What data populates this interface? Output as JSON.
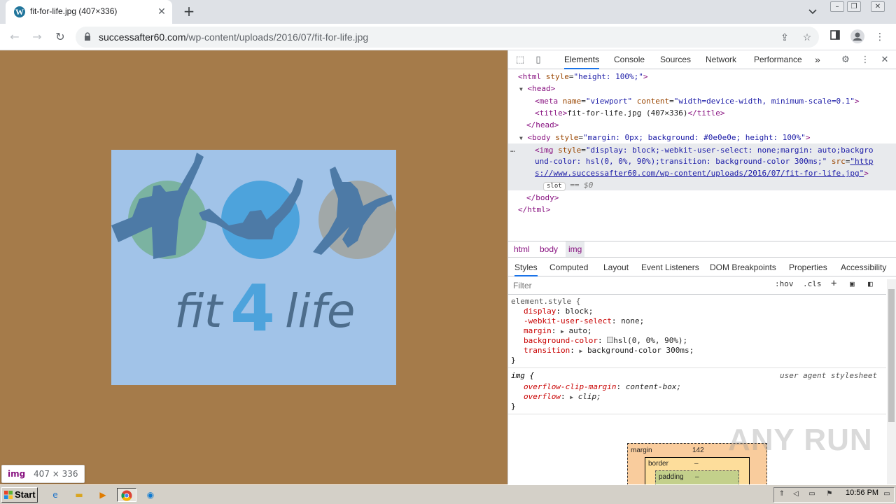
{
  "browser": {
    "tab_title": "fit-for-life.jpg (407×336)",
    "tab_favicon": "wordpress-icon",
    "url_host": "successafter60.com",
    "url_path": "/wp-content/uploads/2016/07/fit-for-life.jpg"
  },
  "page": {
    "background_color": "#a57b4a",
    "image_background": "#a1c3e8",
    "image_alt": "fit-for-life.jpg",
    "logo_text_part1": "fit",
    "logo_text_number": "4",
    "logo_text_part2": "life",
    "tooltip_tag": "img",
    "tooltip_dims": "407 × 336"
  },
  "devtools": {
    "tabs": [
      "Elements",
      "Console",
      "Sources",
      "Network",
      "Performance"
    ],
    "active_tab": "Elements",
    "more_tabs": "»",
    "dom": {
      "html_open": "<html",
      "html_attr": "style",
      "html_val": "\"height: 100%;\"",
      "head_open": "<head>",
      "meta_tag": "<meta",
      "meta_attr1": "name",
      "meta_val1": "\"viewport\"",
      "meta_attr2": "content",
      "meta_val2": "\"width=device-width, minimum-scale=0.1\"",
      "title_open": "<title>",
      "title_text": "fit-for-life.jpg (407×336)",
      "title_close": "</title>",
      "head_close": "</head>",
      "body_open": "<body",
      "body_attr": "style",
      "body_val": "\"margin: 0px; background: #0e0e0e; height: 100%\"",
      "img_tag": "<img",
      "img_attr": "style",
      "img_val_line1": "\"display: block;-webkit-user-select: none;margin: auto;backgro",
      "img_val_line2": "und-color: hsl(0, 0%, 90%);transition: background-color 300ms;\"",
      "img_src_attr": "src",
      "img_src_line1": "\"http",
      "img_src_line2": "s://www.successafter60.com/wp-content/uploads/2016/07/fit-for-life.jpg\"",
      "slot_label": "slot",
      "selected_marker": "== $0",
      "ellipsis": "…",
      "body_close": "</body>",
      "html_close": "</html>"
    },
    "breadcrumbs": [
      "html",
      "body",
      "img"
    ],
    "styles_tabs": [
      "Styles",
      "Computed",
      "Layout",
      "Event Listeners",
      "DOM Breakpoints",
      "Properties",
      "Accessibility"
    ],
    "filter_placeholder": "Filter",
    "filter_hov": ":hov",
    "filter_cls": ".cls",
    "element_style": {
      "selector": "element.style {",
      "rules": [
        {
          "prop": "display",
          "value": "block;"
        },
        {
          "prop": "-webkit-user-select",
          "value": "none;"
        },
        {
          "prop": "margin",
          "value": "auto;"
        },
        {
          "prop": "background-color",
          "value": "hsl(0, 0%, 90%);"
        },
        {
          "prop": "transition",
          "value": "background-color 300ms;"
        }
      ],
      "close": "}"
    },
    "ua_style": {
      "selector": "img {",
      "source": "user agent stylesheet",
      "rules": [
        {
          "prop": "overflow-clip-margin",
          "value": "content-box;"
        },
        {
          "prop": "overflow",
          "value": "clip;"
        }
      ],
      "close": "}"
    },
    "box_model": {
      "margin_label": "margin",
      "margin_value": "142",
      "border_label": "border",
      "border_value": "–",
      "padding_label": "padding",
      "padding_value": "–"
    }
  },
  "watermark": "ANY RUN",
  "taskbar": {
    "start_label": "Start",
    "clock": "10:56 PM"
  }
}
